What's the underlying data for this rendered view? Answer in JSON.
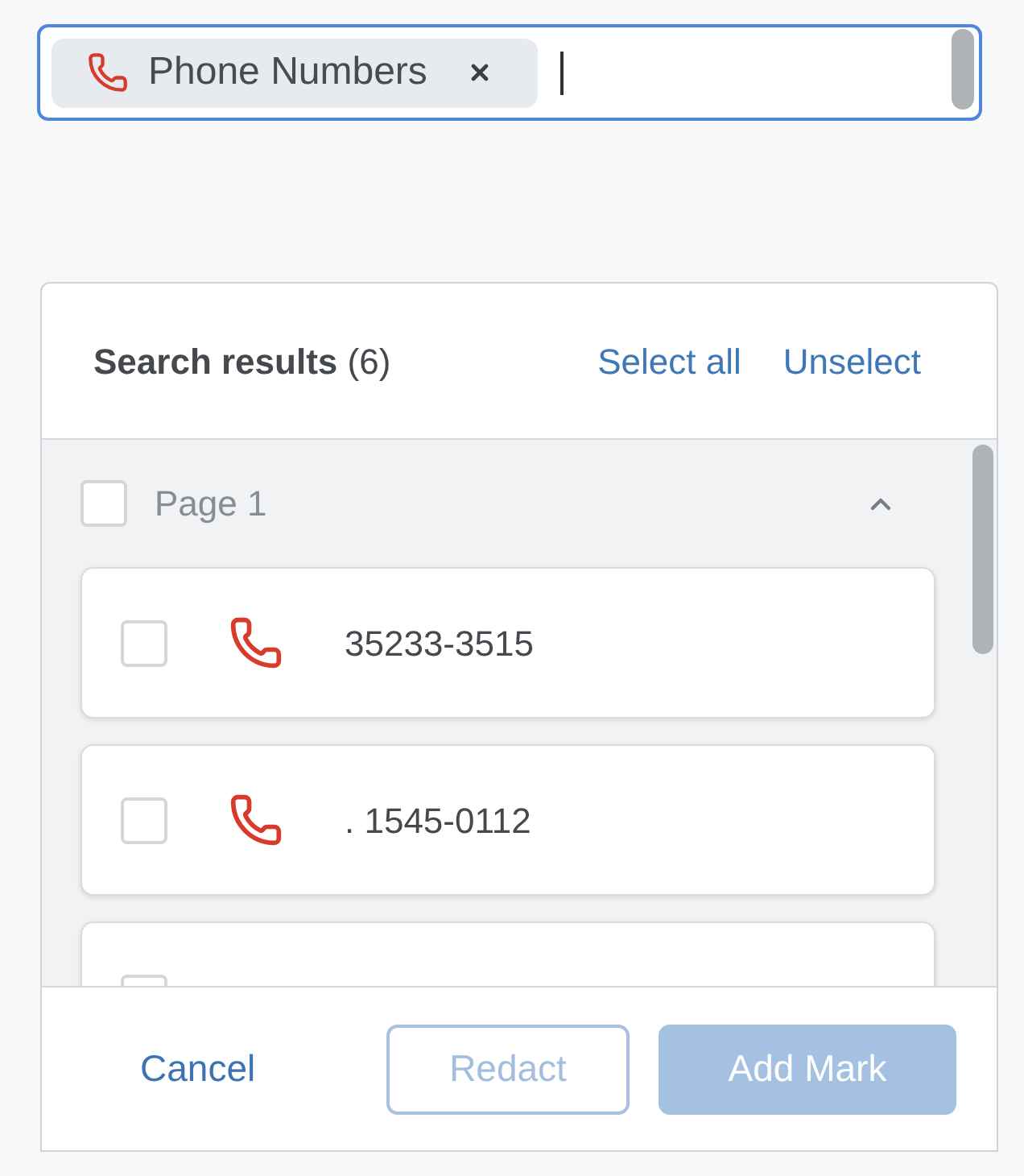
{
  "search_field": {
    "tags": [
      {
        "label": "Phone Numbers"
      }
    ]
  },
  "results": {
    "title": "**Search results** (6)",
    "actions": [
      "Select all",
      "Unselect"
    ]
  },
  "groups": [
    {
      "label": "Page 1",
      "checked": false,
      "expanded": true,
      "items": [
        {
          "text": "35233-3515",
          "checked": false
        },
        {
          "text": ". 1545-0112",
          "checked": false
        },
        {
          "checked": false
        }
      ]
    }
  ],
  "footer": {
    "cancel": "Cancel",
    "buttons": [
      {
        "label": "Redact",
        "kind": "outline",
        "disabled": true
      },
      {
        "label": "Add Mark",
        "kind": "primary",
        "disabled": true
      }
    ]
  }
}
